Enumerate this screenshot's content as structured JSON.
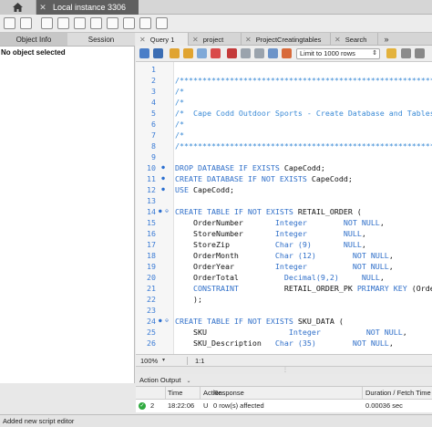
{
  "connection_tab": {
    "label": "Local instance 3306",
    "close": "✕"
  },
  "left_panel": {
    "tabs": [
      "Object Info",
      "Session"
    ],
    "message": "No object selected"
  },
  "editor_tabs": [
    {
      "label": "Query 1",
      "active": true
    },
    {
      "label": "project",
      "active": false
    },
    {
      "label": "ProjectCreatingtables",
      "active": false
    },
    {
      "label": "Search",
      "active": false
    }
  ],
  "editor_tabs_more": "»",
  "editor_toolbar": {
    "limit_select": "Limit to 1000 rows"
  },
  "code_lines": [
    {
      "n": "1",
      "fold": "",
      "segs": [
        {
          "t": "",
          "c": ""
        }
      ]
    },
    {
      "n": "2",
      "fold": "",
      "segs": [
        {
          "t": "/***********************************************************",
          "c": "cm"
        }
      ]
    },
    {
      "n": "3",
      "fold": "",
      "segs": [
        {
          "t": "/*",
          "c": "cm"
        }
      ]
    },
    {
      "n": "4",
      "fold": "",
      "segs": [
        {
          "t": "/*",
          "c": "cm"
        }
      ]
    },
    {
      "n": "5",
      "fold": "",
      "segs": [
        {
          "t": "/*  Cape Codd Outdoor Sports - Create Database and Tables",
          "c": "cm"
        }
      ]
    },
    {
      "n": "6",
      "fold": "",
      "segs": [
        {
          "t": "/*",
          "c": "cm"
        }
      ]
    },
    {
      "n": "7",
      "fold": "",
      "segs": [
        {
          "t": "/*",
          "c": "cm"
        }
      ]
    },
    {
      "n": "8",
      "fold": "",
      "segs": [
        {
          "t": "/***********************************************************",
          "c": "cm"
        }
      ]
    },
    {
      "n": "9",
      "fold": "",
      "segs": [
        {
          "t": "",
          "c": ""
        }
      ]
    },
    {
      "n": "10",
      "fold": "●",
      "segs": [
        {
          "t": "DROP DATABASE IF EXISTS",
          "c": "kw"
        },
        {
          "t": " CapeCodd;",
          "c": ""
        }
      ]
    },
    {
      "n": "11",
      "fold": "●",
      "segs": [
        {
          "t": "CREATE DATABASE IF NOT EXISTS",
          "c": "kw"
        },
        {
          "t": " CapeCodd;",
          "c": ""
        }
      ]
    },
    {
      "n": "12",
      "fold": "●",
      "segs": [
        {
          "t": "USE",
          "c": "kw"
        },
        {
          "t": " CapeCodd;",
          "c": ""
        }
      ]
    },
    {
      "n": "13",
      "fold": "",
      "segs": [
        {
          "t": "",
          "c": ""
        }
      ]
    },
    {
      "n": "14",
      "fold": "● ⊖",
      "segs": [
        {
          "t": "CREATE TABLE IF NOT EXISTS",
          "c": "kw"
        },
        {
          "t": " RETAIL_ORDER (",
          "c": ""
        }
      ]
    },
    {
      "n": "15",
      "fold": "",
      "segs": [
        {
          "t": "    OrderNumber       ",
          "c": ""
        },
        {
          "t": "Integer",
          "c": "ty"
        },
        {
          "t": "        ",
          "c": ""
        },
        {
          "t": "NOT NULL",
          "c": "kw"
        },
        {
          "t": ",",
          "c": ""
        }
      ]
    },
    {
      "n": "16",
      "fold": "",
      "segs": [
        {
          "t": "    StoreNumber       ",
          "c": ""
        },
        {
          "t": "Integer",
          "c": "ty"
        },
        {
          "t": "        ",
          "c": ""
        },
        {
          "t": "NULL",
          "c": "kw"
        },
        {
          "t": ",",
          "c": ""
        }
      ]
    },
    {
      "n": "17",
      "fold": "",
      "segs": [
        {
          "t": "    StoreZip          ",
          "c": ""
        },
        {
          "t": "Char (9)",
          "c": "ty"
        },
        {
          "t": "       ",
          "c": ""
        },
        {
          "t": "NULL",
          "c": "kw"
        },
        {
          "t": ",",
          "c": ""
        }
      ]
    },
    {
      "n": "18",
      "fold": "",
      "segs": [
        {
          "t": "    OrderMonth        ",
          "c": ""
        },
        {
          "t": "Char (12)",
          "c": "ty"
        },
        {
          "t": "        ",
          "c": ""
        },
        {
          "t": "NOT NULL",
          "c": "kw"
        },
        {
          "t": ",",
          "c": ""
        }
      ]
    },
    {
      "n": "19",
      "fold": "",
      "segs": [
        {
          "t": "    OrderYear         ",
          "c": ""
        },
        {
          "t": "Integer",
          "c": "ty"
        },
        {
          "t": "          ",
          "c": ""
        },
        {
          "t": "NOT NULL",
          "c": "kw"
        },
        {
          "t": ",",
          "c": ""
        }
      ]
    },
    {
      "n": "20",
      "fold": "",
      "segs": [
        {
          "t": "    OrderTotal          ",
          "c": ""
        },
        {
          "t": "Decimal(9,2)",
          "c": "ty"
        },
        {
          "t": "     ",
          "c": ""
        },
        {
          "t": "NULL",
          "c": "kw"
        },
        {
          "t": ",",
          "c": ""
        }
      ]
    },
    {
      "n": "21",
      "fold": "",
      "segs": [
        {
          "t": "    CONSTRAINT",
          "c": "kw"
        },
        {
          "t": "          RETAIL_ORDER_PK ",
          "c": ""
        },
        {
          "t": "PRIMARY KEY",
          "c": "kw"
        },
        {
          "t": " (OrderNumb",
          "c": ""
        }
      ]
    },
    {
      "n": "22",
      "fold": "",
      "segs": [
        {
          "t": "    );",
          "c": ""
        }
      ]
    },
    {
      "n": "23",
      "fold": "",
      "segs": [
        {
          "t": "",
          "c": ""
        }
      ]
    },
    {
      "n": "24",
      "fold": "● ⊖",
      "segs": [
        {
          "t": "CREATE TABLE IF NOT EXISTS",
          "c": "kw"
        },
        {
          "t": " SKU_DATA (",
          "c": ""
        }
      ]
    },
    {
      "n": "25",
      "fold": "",
      "segs": [
        {
          "t": "    SKU                  ",
          "c": ""
        },
        {
          "t": "Integer",
          "c": "ty"
        },
        {
          "t": "          ",
          "c": ""
        },
        {
          "t": "NOT NULL",
          "c": "kw"
        },
        {
          "t": ",",
          "c": ""
        }
      ]
    },
    {
      "n": "26",
      "fold": "",
      "segs": [
        {
          "t": "    SKU_Description   ",
          "c": ""
        },
        {
          "t": "Char (35)",
          "c": "ty"
        },
        {
          "t": "        ",
          "c": ""
        },
        {
          "t": "NOT NULL",
          "c": "kw"
        },
        {
          "t": ",",
          "c": ""
        }
      ]
    }
  ],
  "editor_status": {
    "zoom": "100%",
    "zoom_arrow": "▾",
    "position": "1:1"
  },
  "output": {
    "selector": "Action Output",
    "selector_arrow": "⌄",
    "columns": [
      "",
      "Time",
      "Action",
      "Response",
      "Duration / Fetch Time"
    ],
    "rows": [
      {
        "status": "✓",
        "num": "2",
        "time": "18:22:06",
        "action": "U",
        "response": "0 row(s) affected",
        "duration": "0.00036 sec"
      }
    ]
  },
  "statusbar": {
    "message": "Added new script editor"
  },
  "colors": {
    "keyword": "#2f6fc9",
    "comment": "#3a8ad6",
    "line_number": "#3a7bd5",
    "ok": "#2faa3f",
    "active_tab": "#5f5f5f"
  }
}
